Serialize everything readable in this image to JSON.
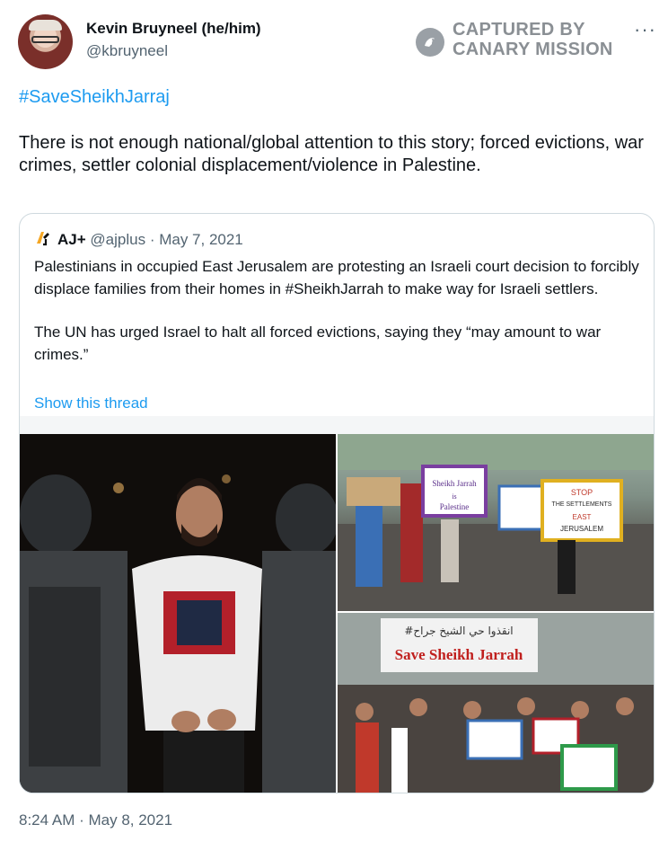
{
  "author": {
    "name": "Kevin Bruyneel (he/him)",
    "handle": "@kbruyneel"
  },
  "watermark": {
    "line1": "CAPTURED BY",
    "line2": "CANARY MISSION"
  },
  "menu": {
    "more_label": "···"
  },
  "tweet": {
    "hashtag": "#SaveSheikhJarraj",
    "text": "There is not enough national/global attention to this story; forced evictions, war crimes, settler colonial displacement/violence in Palestine.",
    "timestamp": "8:24 AM · May 8, 2021"
  },
  "quoted": {
    "name": "AJ+",
    "handle": "@ajplus",
    "date": "May 7, 2021",
    "paragraph1": "Palestinians in occupied East Jerusalem are protesting an Israeli court decision to forcibly displace families from their homes in #SheikhJarrah to make way for Israeli settlers.",
    "paragraph2": "The UN has urged Israel to halt all forced evictions, saying they “may amount to war crimes.”",
    "show_thread": "Show this thread",
    "images": {
      "top_right_signs": [
        "Sheikh Jarrah is Palestine",
        "STOP THE SETTLEMENTS IN EAST JERUSALEM"
      ],
      "bottom_right_banner": "Save Sheikh Jarrah"
    }
  },
  "colors": {
    "link": "#1d9bf0",
    "secondary_text": "#536471",
    "border": "#cfd9de"
  }
}
